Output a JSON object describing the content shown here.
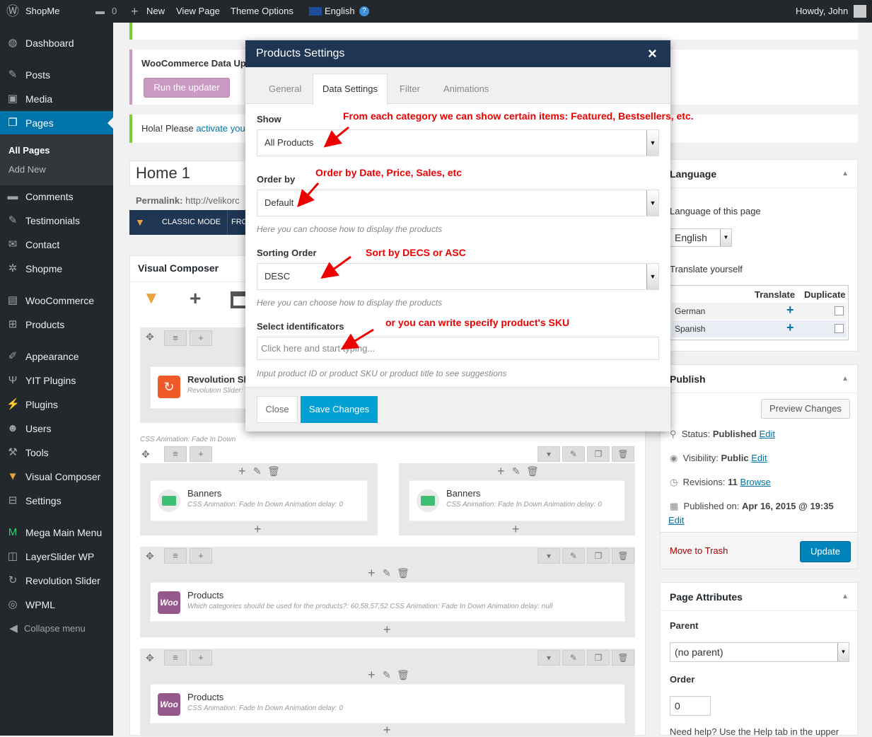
{
  "adminbar": {
    "site_name": "ShopMe",
    "comments_count": "0",
    "new_label": "New",
    "view_page": "View Page",
    "theme_options": "Theme Options",
    "language": "English",
    "howdy": "Howdy, John"
  },
  "sidebar": {
    "items": [
      {
        "label": "Dashboard",
        "icon": "dashboard-icon"
      },
      {
        "label": "Posts",
        "icon": "pin-icon"
      },
      {
        "label": "Media",
        "icon": "media-icon"
      },
      {
        "label": "Pages",
        "icon": "pages-icon"
      },
      {
        "label": "Comments",
        "icon": "comment-icon"
      },
      {
        "label": "Testimonials",
        "icon": "pencil-icon"
      },
      {
        "label": "Contact",
        "icon": "mail-icon"
      },
      {
        "label": "Shopme",
        "icon": "gear-icon"
      },
      {
        "label": "WooCommerce",
        "icon": "woo-icon"
      },
      {
        "label": "Products",
        "icon": "cart-icon"
      },
      {
        "label": "Appearance",
        "icon": "brush-icon"
      },
      {
        "label": "YIT Plugins",
        "icon": "plugin-icon"
      },
      {
        "label": "Plugins",
        "icon": "plug-icon"
      },
      {
        "label": "Users",
        "icon": "user-icon"
      },
      {
        "label": "Tools",
        "icon": "wrench-icon"
      },
      {
        "label": "Visual Composer",
        "icon": "vc-icon"
      },
      {
        "label": "Settings",
        "icon": "settings-icon"
      },
      {
        "label": "Mega Main Menu",
        "icon": "menu-icon"
      },
      {
        "label": "LayerSlider WP",
        "icon": "layers-icon"
      },
      {
        "label": "Revolution Slider",
        "icon": "refresh-icon"
      },
      {
        "label": "WPML",
        "icon": "globe-icon"
      }
    ],
    "submenu": [
      "All Pages",
      "Add New"
    ],
    "collapse": "Collapse menu"
  },
  "notices": {
    "woo_title": "WooCommerce Data Up",
    "run_updater": "Run the updater",
    "hola_text": "Hola! Please ",
    "hola_link": "activate you"
  },
  "editor": {
    "title": "Home 1",
    "permalink_label": "Permalink:",
    "permalink_url": "http://velikorc",
    "classic_mode": "CLASSIC MODE",
    "frontend": "FRO"
  },
  "vc": {
    "title": "Visual Composer",
    "css_anim_label": "CSS Animation: Fade In Down",
    "elements": {
      "rev_title": "Revolution Sli",
      "rev_sub": "Revolution Slider:",
      "banners1_title": "Banners",
      "banners1_sub": "CSS Animation: Fade In Down  Animation delay: 0",
      "banners2_title": "Banners",
      "banners2_sub": "CSS Animation: Fade In Down  Animation delay: 0",
      "products1_title": "Products",
      "products1_sub": "Which categories should be used for the products?: 60,58,57,52  CSS Animation: Fade In Down  Animation delay: null",
      "products2_title": "Products",
      "products2_sub": "CSS Animation: Fade In Down  Animation delay: 0",
      "woo_badge": "Woo"
    }
  },
  "modal": {
    "title": "Products Settings",
    "close_x": "×",
    "tabs": [
      "General",
      "Data Settings",
      "Filter",
      "Animations"
    ],
    "active_tab": "Data Settings",
    "show_label": "Show",
    "show_value": "All Products",
    "order_by_label": "Order by",
    "order_by_value": "Default",
    "hint1": "Here you can choose how to display the products",
    "sorting_label": "Sorting Order",
    "sorting_value": "DESC",
    "hint2": "Here you can choose how to display the products",
    "select_ident_label": "Select identificators",
    "select_ident_placeholder": "Click here and start typing...",
    "hint3": "Input product ID or product SKU or product title to see suggestions",
    "close_btn": "Close",
    "save_btn": "Save Changes"
  },
  "annotations": {
    "a1": "From each category we can show certain items: Featured, Bestsellers, etc.",
    "a2": "Order by Date, Price, Sales, etc",
    "a3": "Sort by DECS or ASC",
    "a4": "or you can write specify product's SKU"
  },
  "language_box": {
    "title": "Language",
    "lang_of_page": "Language of this page",
    "lang_value": "English",
    "translate_yourself": "Translate yourself",
    "col_translate": "Translate",
    "col_duplicate": "Duplicate",
    "rows": [
      "German",
      "Spanish"
    ]
  },
  "publish_box": {
    "title": "Publish",
    "preview": "Preview Changes",
    "status_label": "Status:",
    "status_value": "Published",
    "visibility_label": "Visibility:",
    "visibility_value": "Public",
    "revisions_label": "Revisions:",
    "revisions_value": "11",
    "browse": "Browse",
    "published_label": "Published on:",
    "published_value": "Apr 16, 2015 @ 19:35",
    "edit": "Edit",
    "trash": "Move to Trash",
    "update": "Update"
  },
  "attributes_box": {
    "title": "Page Attributes",
    "parent_label": "Parent",
    "parent_value": "(no parent)",
    "order_label": "Order",
    "order_value": "0",
    "help": "Need help? Use the Help tab in the upper"
  },
  "colors": {
    "accent": "#0073aa",
    "modal_header": "#1e3553",
    "save_button": "#00a0d2",
    "annotation": "#e00000"
  }
}
